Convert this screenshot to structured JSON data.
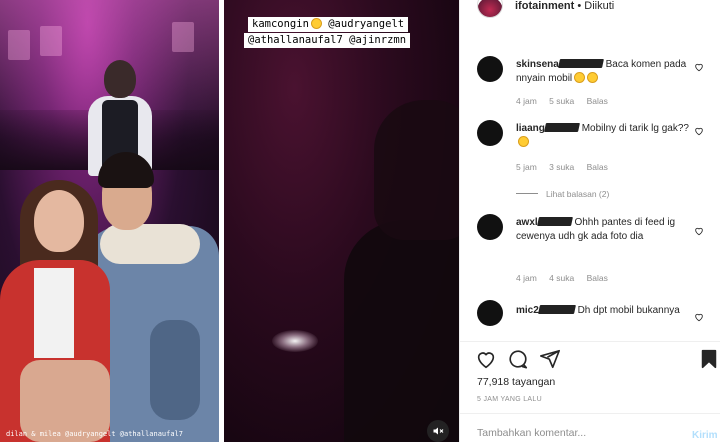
{
  "story": {
    "caption_left": "dilan & milea @audryangelt @athallanaufal7",
    "sticker_line1": "kamcongin",
    "sticker_mention1": "@audryangelt",
    "sticker_line2": "@athallanaufal7  @ajinrzmn"
  },
  "header": {
    "username": "ifotainment",
    "dot": " • ",
    "follow_status": "Diikuti"
  },
  "comments": [
    {
      "user": "skinsena",
      "text": "Baca komen pada nnyain mobil",
      "emoji_count": 2,
      "time": "4 jam",
      "likes": "5 suka",
      "reply": "Balas"
    },
    {
      "user": "liaang",
      "text": "Mobilny di tarik lg gak??",
      "emoji_count": 1,
      "time": "5 jam",
      "likes": "3 suka",
      "reply": "Balas",
      "view_replies": "Lihat balasan (2)"
    },
    {
      "user": "awxl",
      "text": "Ohhh pantes di feed ig cewenya udh gk ada foto dia",
      "emoji_count": 0,
      "time": "4 jam",
      "likes": "4 suka",
      "reply": "Balas"
    },
    {
      "user": "mic2",
      "text": "Dh dpt mobil bukannya",
      "emoji_count": 0
    }
  ],
  "post": {
    "views": "77,918 tayangan",
    "timestamp": "5 JAM YANG LALU"
  },
  "comment_box": {
    "placeholder": "Tambahkan komentar...",
    "post_label": "Kirim"
  },
  "icons": [
    "heart-icon",
    "comment-icon",
    "share-icon",
    "bookmark-icon",
    "mute-icon",
    "small-heart-icon"
  ],
  "colors": {
    "text": "#262626",
    "muted": "#8e8e8e",
    "post_button_disabled": "#b2dffc",
    "divider": "#efefef"
  }
}
